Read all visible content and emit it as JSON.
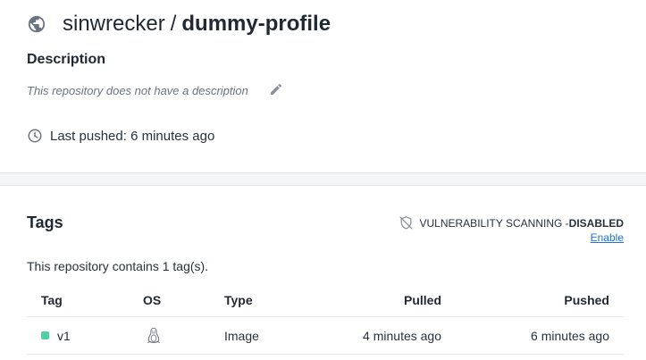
{
  "repo": {
    "owner": "sinwrecker",
    "separator": "/",
    "name": "dummy-profile"
  },
  "description": {
    "heading": "Description",
    "text": "This repository does not have a description"
  },
  "last_pushed": "Last pushed: 6 minutes ago",
  "tags_section": {
    "heading": "Tags",
    "vuln_label": "VULNERABILITY SCANNING - ",
    "vuln_status": "DISABLED",
    "enable_label": "Enable",
    "count_text": "This repository contains 1 tag(s).",
    "columns": {
      "tag": "Tag",
      "os": "OS",
      "type": "Type",
      "pulled": "Pulled",
      "pushed": "Pushed"
    },
    "rows": [
      {
        "tag": "v1",
        "os_icon": "linux-icon",
        "type": "Image",
        "pulled": "4 minutes ago",
        "pushed": "6 minutes ago",
        "status_color": "#4fd1a5"
      }
    ]
  },
  "colors": {
    "link": "#1a73e8",
    "status_active": "#4fd1a5",
    "band": "#f4f5f7"
  }
}
